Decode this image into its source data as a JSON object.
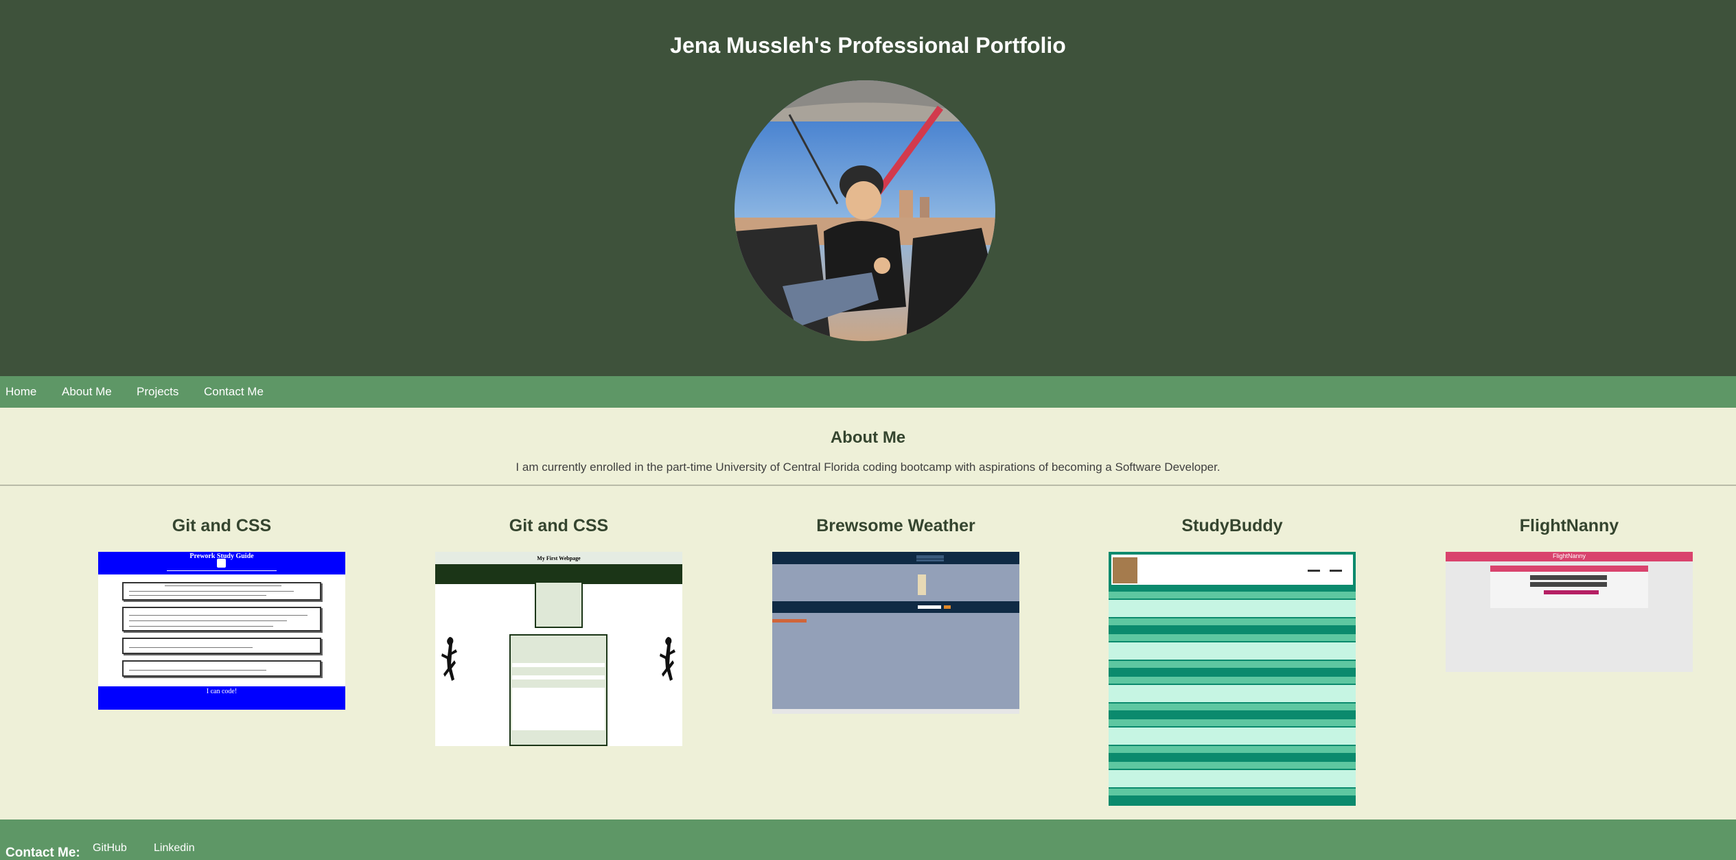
{
  "header": {
    "title": "Jena Mussleh's Professional Portfolio"
  },
  "nav": {
    "items": [
      {
        "label": "Home"
      },
      {
        "label": "About Me"
      },
      {
        "label": "Projects"
      },
      {
        "label": "Contact Me"
      }
    ]
  },
  "about": {
    "title": "About Me",
    "text": "I am currently enrolled in the part-time University of Central Florida coding bootcamp with aspirations of becoming a Software Developer."
  },
  "projects": [
    {
      "title": "Git and CSS",
      "thumb_title": "Prework Study Guide",
      "thumb_footer": "I can code!"
    },
    {
      "title": "Git and CSS",
      "thumb_title": "My First Webpage"
    },
    {
      "title": "Brewsome Weather"
    },
    {
      "title": "StudyBuddy"
    },
    {
      "title": "FlightNanny",
      "thumb_title": "FlightNanny"
    }
  ],
  "footer": {
    "label": "Contact Me:",
    "links": [
      {
        "label": "GitHub"
      },
      {
        "label": "Linkedin"
      }
    ]
  },
  "colors": {
    "header_bg": "#3e523b",
    "nav_bg": "#5e9766",
    "page_bg": "#eef0d8",
    "heading": "#35452f"
  }
}
